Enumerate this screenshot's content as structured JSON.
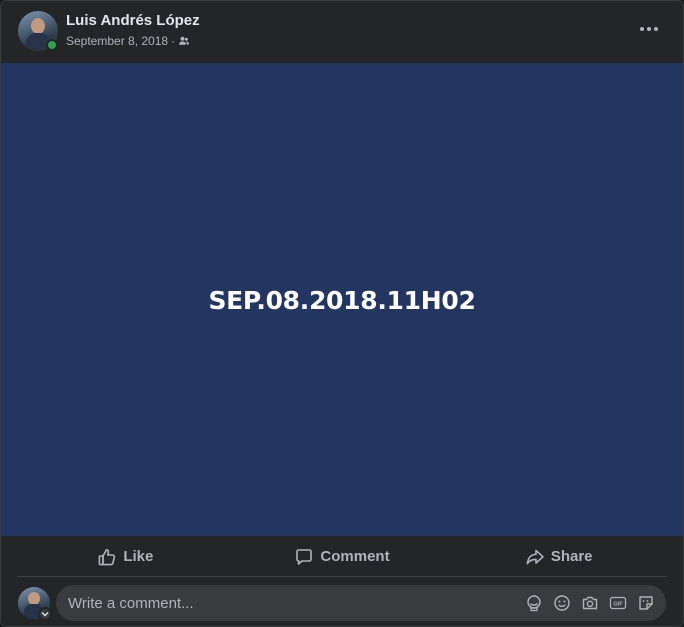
{
  "post": {
    "author": "Luis Andrés López",
    "date": "September 8, 2018",
    "separator": "·",
    "audience_icon": "friends-icon",
    "image_text": "SEP.08.2018.11H02",
    "image_background": "#233561"
  },
  "actions": {
    "like_label": "Like",
    "comment_label": "Comment",
    "share_label": "Share"
  },
  "comment_box": {
    "placeholder": "Write a comment...",
    "value": "",
    "tools": [
      "avatar-sticker-icon",
      "emoji-icon",
      "camera-icon",
      "gif-icon",
      "sticker-icon"
    ]
  },
  "colors": {
    "card_background": "#242526",
    "online_status": "#31a24c",
    "text_secondary": "#b0b3b8"
  }
}
